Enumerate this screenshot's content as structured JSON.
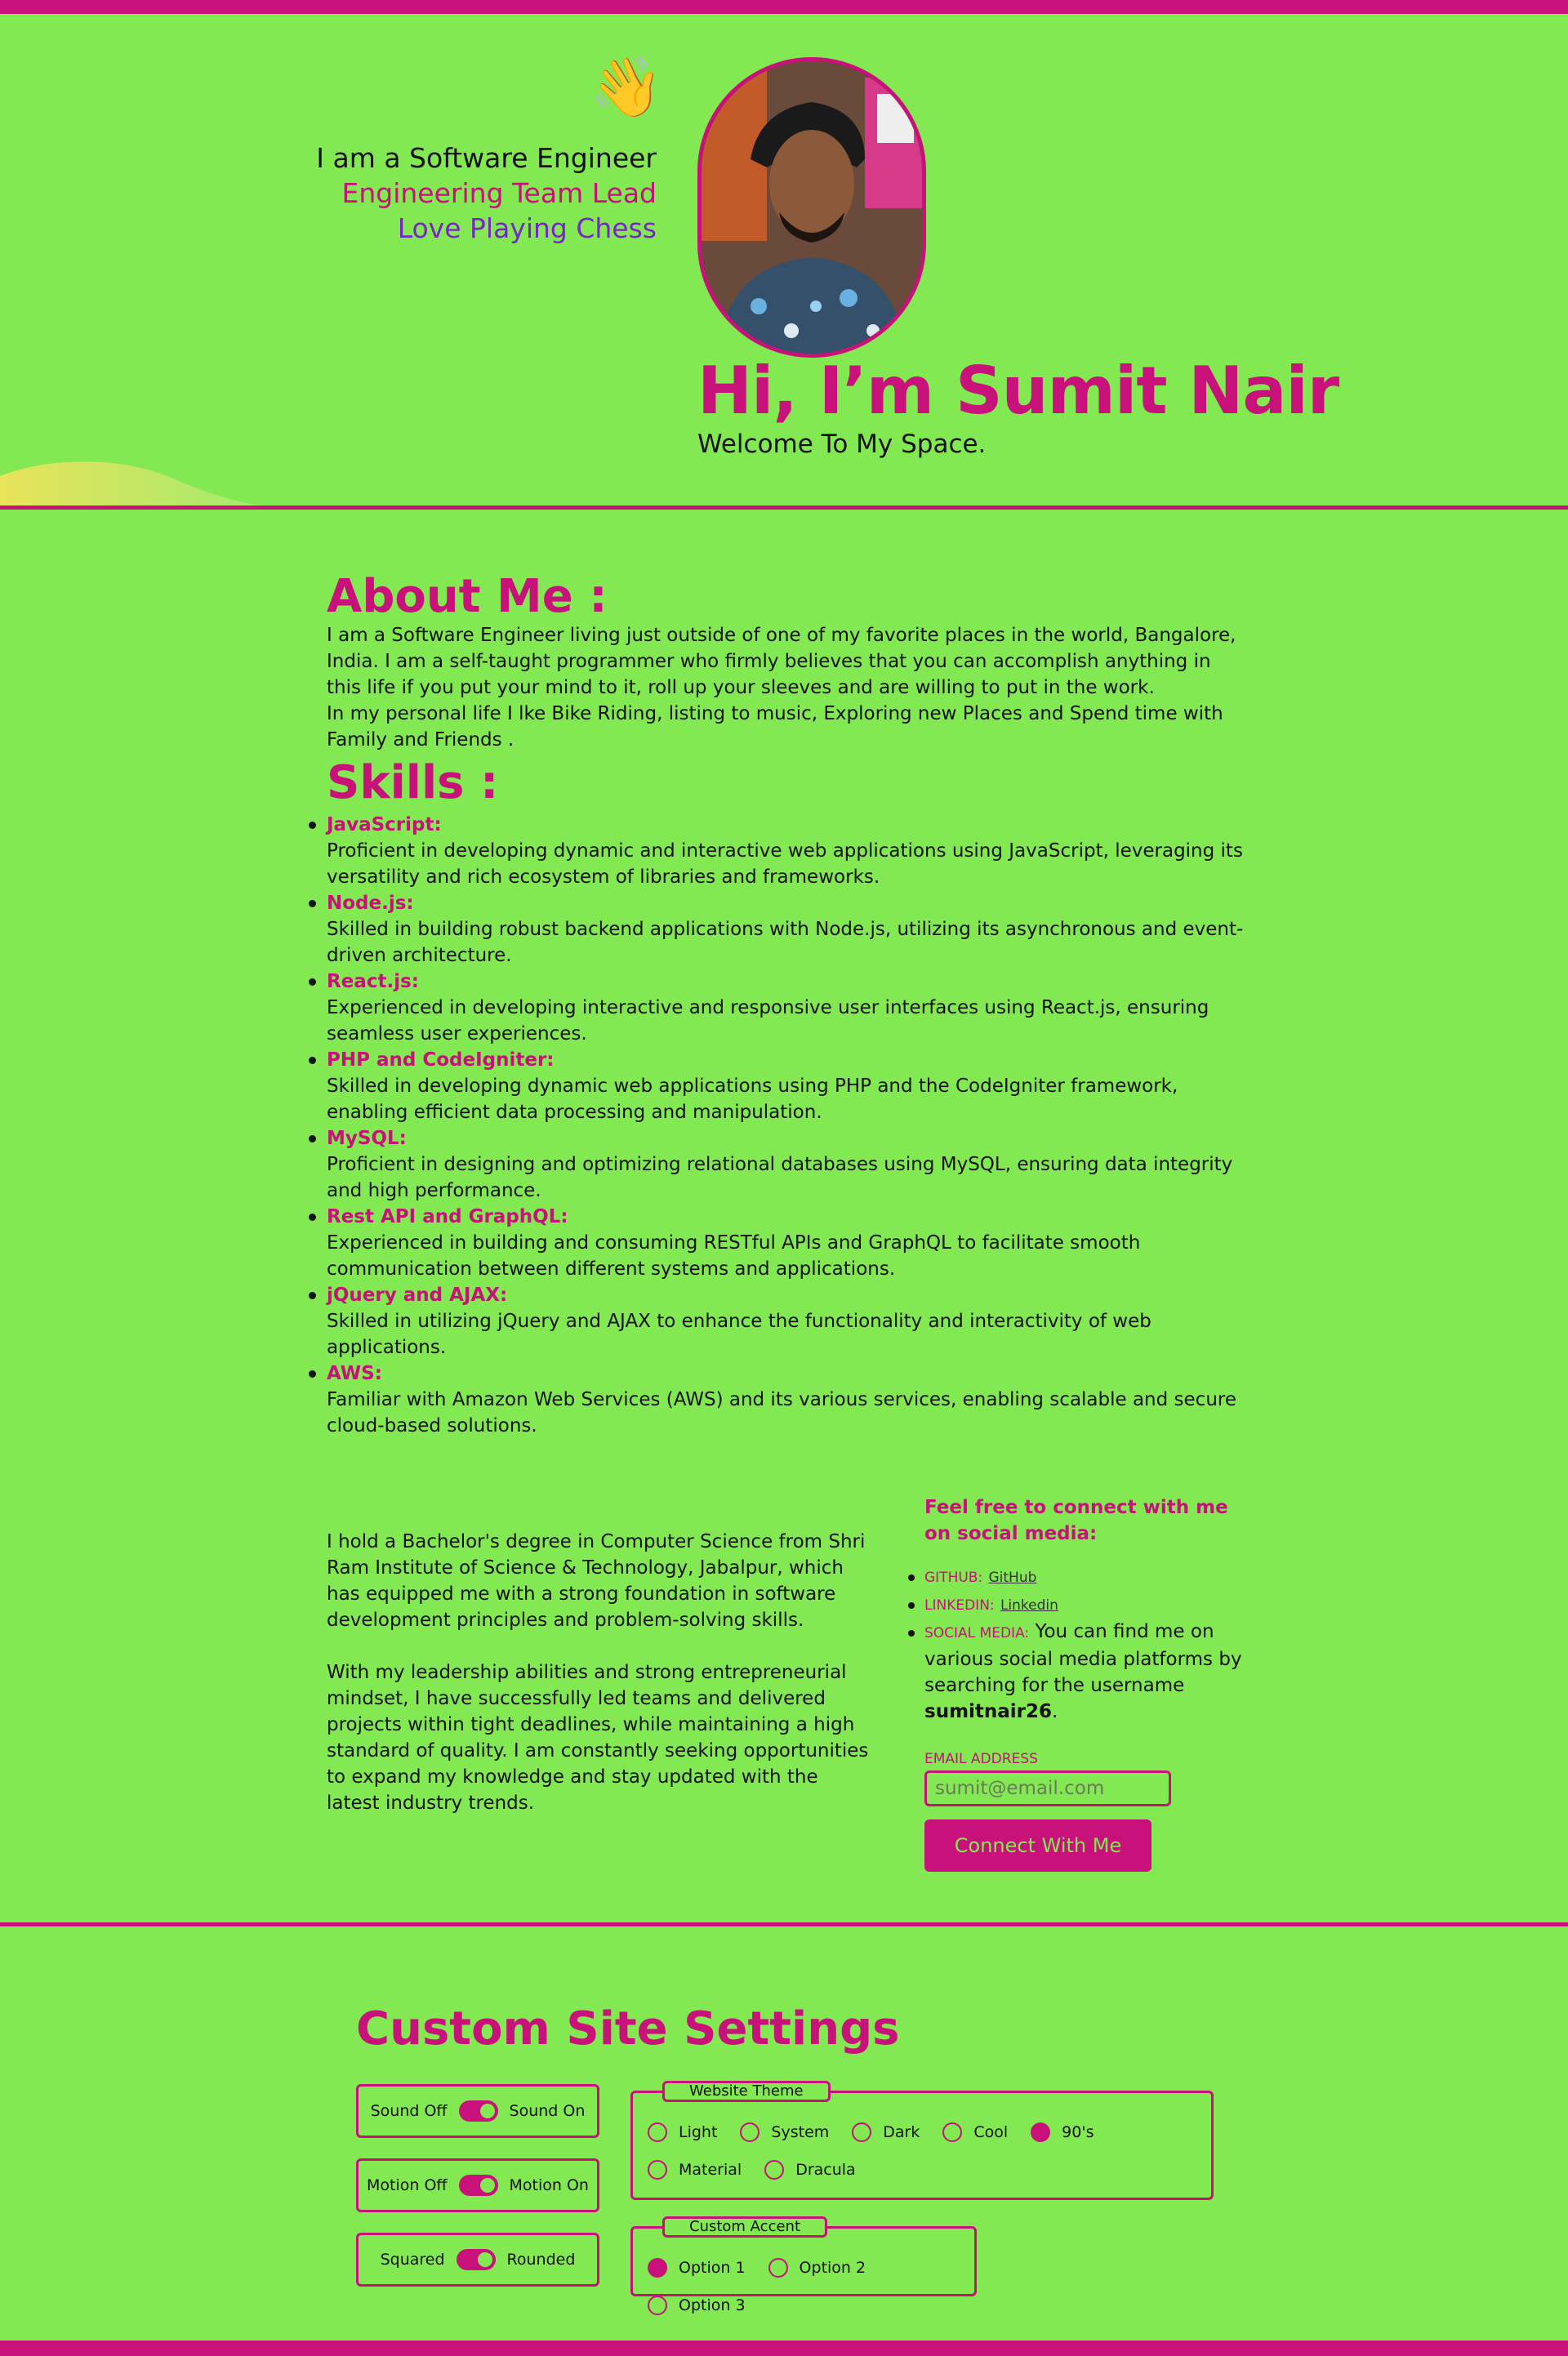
{
  "hero": {
    "wave_emoji": "👋",
    "taglines": [
      "I am a Software Engineer",
      "Engineering Team Lead",
      "Love Playing Chess"
    ],
    "title": "Hi, I’m Sumit Nair",
    "subtitle": "Welcome To My Space."
  },
  "about": {
    "title": "About Me :",
    "paragraph1": "I am a Software Engineer living just outside of one of my favorite places in the world, Bangalore, India. I am a self-taught programmer who firmly believes that you can accomplish anything in this life if you put your mind to it, roll up your sleeves and are willing to put in the work.",
    "paragraph2": "In my personal life I lke Bike Riding, listing to music, Exploring new Places and Spend time with Family and Friends ."
  },
  "skills": {
    "title": "Skills :",
    "items": [
      {
        "name": "JavaScript:",
        "desc": "Proficient in developing dynamic and interactive web applications using JavaScript, leveraging its versatility and rich ecosystem of libraries and frameworks."
      },
      {
        "name": "Node.js:",
        "desc": "Skilled in building robust backend applications with Node.js, utilizing its asynchronous and event-driven architecture."
      },
      {
        "name": "React.js:",
        "desc": "Experienced in developing interactive and responsive user interfaces using React.js, ensuring seamless user experiences."
      },
      {
        "name": "PHP and CodeIgniter:",
        "desc": "Skilled in developing dynamic web applications using PHP and the CodeIgniter framework, enabling efficient data processing and manipulation."
      },
      {
        "name": "MySQL:",
        "desc": "Proficient in designing and optimizing relational databases using MySQL, ensuring data integrity and high performance."
      },
      {
        "name": "Rest API and GraphQL:",
        "desc": "Experienced in building and consuming RESTful APIs and GraphQL to facilitate smooth communication between different systems and applications."
      },
      {
        "name": "jQuery and AJAX:",
        "desc": "Skilled in utilizing jQuery and AJAX to enhance the functionality and interactivity of web applications."
      },
      {
        "name": "AWS:",
        "desc": "Familiar with Amazon Web Services (AWS) and its various services, enabling scalable and secure cloud-based solutions."
      }
    ]
  },
  "education": {
    "paragraph1": "I hold a Bachelor's degree in Computer Science from Shri Ram Institute of Science & Technology, Jabalpur, which has equipped me with a strong foundation in software development principles and problem-solving skills.",
    "paragraph2": "With my leadership abilities and strong entrepreneurial mindset, I have successfully led teams and delivered projects within tight deadlines, while maintaining a high standard of quality. I am constantly seeking opportunities to expand my knowledge and stay updated with the latest industry trends."
  },
  "connect": {
    "title": "Feel free to connect with me on social media:",
    "github_label": "GITHUB:",
    "github_link": "GitHub",
    "linkedin_label": "LINKEDIN:",
    "linkedin_link": "Linkedin",
    "social_label": "SOCIAL MEDIA:",
    "social_text": "You can find me on various social media platforms by searching for the username",
    "username": "sumitnair26",
    "period": ".",
    "email_label": "EMAIL ADDRESS",
    "email_placeholder": "sumit@email.com",
    "button": "Connect With Me"
  },
  "settings": {
    "title": "Custom Site Settings",
    "toggles": [
      {
        "off": "Sound Off",
        "on": "Sound On"
      },
      {
        "off": "Motion Off",
        "on": "Motion On"
      },
      {
        "off": "Squared",
        "on": "Rounded"
      }
    ],
    "theme_legend": "Website Theme",
    "themes": [
      "Light",
      "System",
      "Dark",
      "Cool",
      "90's",
      "Material",
      "Dracula"
    ],
    "selected_theme": "90's",
    "accent_legend": "Custom Accent",
    "accents": [
      "Option 1",
      "Option 2",
      "Option 3"
    ],
    "selected_accent": "Option 1"
  },
  "colors": {
    "background": "#82e952",
    "accent": "#c8117a",
    "tagline_purple": "#7a25c8"
  }
}
